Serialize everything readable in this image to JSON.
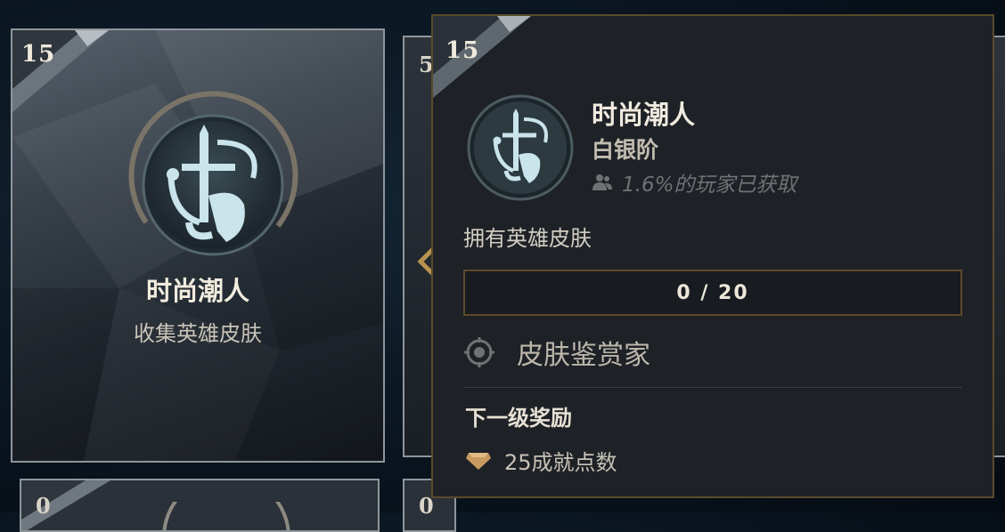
{
  "main_card": {
    "level": "15",
    "title": "时尚潮人",
    "subtitle": "收集英雄皮肤"
  },
  "neighbor_cards": {
    "right_level": "5",
    "bottom_left_level": "0",
    "bottom_mid_level": "0"
  },
  "tooltip": {
    "level": "15",
    "title": "时尚潮人",
    "tier": "白银阶",
    "players_icon": "players-icon",
    "players_text": "1.6%的玩家已获取",
    "description": "拥有英雄皮肤",
    "progress_text": "0 / 20",
    "reward_icon": "target-crosshair-icon",
    "reward_title": "皮肤鉴赏家",
    "next_level_title": "下一级奖励",
    "points_icon": "gem-icon",
    "points_text": "25成就点数"
  },
  "colors": {
    "gold_border": "#5b4a2b",
    "emblem_ice": "#c9e4ea",
    "gem_gold": "#c89a5f"
  }
}
